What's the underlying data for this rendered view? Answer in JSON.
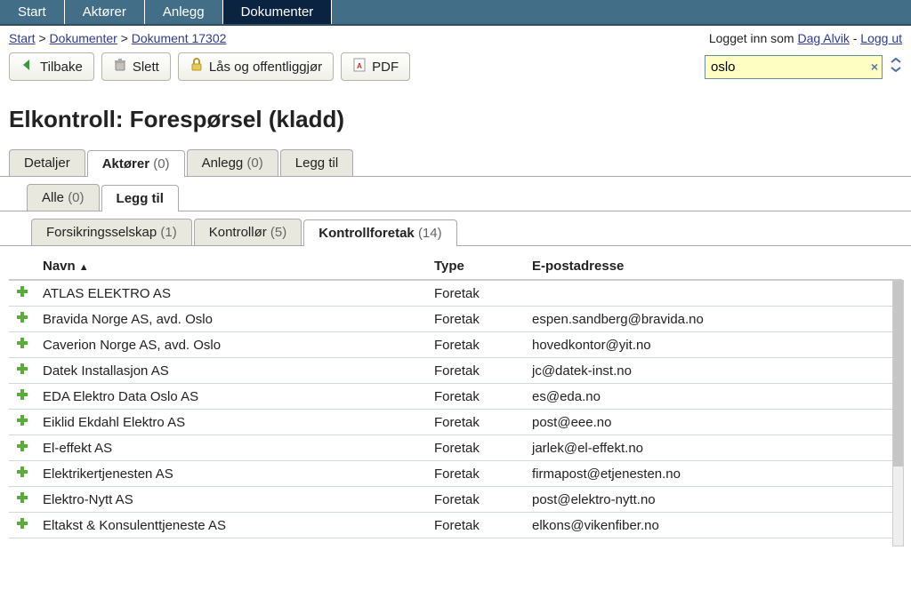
{
  "nav": {
    "start": "Start",
    "aktorer": "Aktører",
    "anlegg": "Anlegg",
    "dokumenter": "Dokumenter"
  },
  "breadcrumb": {
    "start": "Start",
    "dokumenter": "Dokumenter",
    "dokument": "Dokument 17302",
    "sep": ">"
  },
  "user": {
    "logged_in_as_prefix": "Logget inn som ",
    "name": "Dag Alvik",
    "dash": " - ",
    "logout": "Logg ut"
  },
  "toolbar": {
    "back": "Tilbake",
    "delete": "Slett",
    "lock": "Lås og offentliggjør",
    "pdf": "PDF"
  },
  "search": {
    "value": "oslo"
  },
  "title": "Elkontroll: Forespørsel (kladd)",
  "tabs1": {
    "detaljer": "Detaljer",
    "aktorer": "Aktører ",
    "aktorer_count": "(0)",
    "anlegg": "Anlegg ",
    "anlegg_count": "(0)",
    "leggtil": "Legg til"
  },
  "tabs2": {
    "alle": "Alle ",
    "alle_count": "(0)",
    "leggtil": "Legg til"
  },
  "tabs3": {
    "forsikring": "Forsikringsselskap ",
    "forsikring_count": "(1)",
    "kontrollor": "Kontrollør ",
    "kontrollor_count": "(5)",
    "kontrollforetak": "Kontrollforetak ",
    "kontrollforetak_count": "(14)"
  },
  "table": {
    "headers": {
      "navn": "Navn",
      "type": "Type",
      "epost": "E-postadresse"
    },
    "rows": [
      {
        "name": "ATLAS ELEKTRO AS",
        "type": "Foretak",
        "email": ""
      },
      {
        "name": "Bravida Norge AS, avd. Oslo",
        "type": "Foretak",
        "email": "espen.sandberg@bravida.no"
      },
      {
        "name": "Caverion Norge AS, avd. Oslo",
        "type": "Foretak",
        "email": "hovedkontor@yit.no"
      },
      {
        "name": "Datek Installasjon AS",
        "type": "Foretak",
        "email": "jc@datek-inst.no"
      },
      {
        "name": "EDA Elektro Data Oslo AS",
        "type": "Foretak",
        "email": "es@eda.no"
      },
      {
        "name": "Eiklid Ekdahl Elektro AS",
        "type": "Foretak",
        "email": "post@eee.no"
      },
      {
        "name": "El-effekt AS",
        "type": "Foretak",
        "email": "jarlek@el-effekt.no"
      },
      {
        "name": "Elektrikertjenesten AS",
        "type": "Foretak",
        "email": "firmapost@etjenesten.no"
      },
      {
        "name": "Elektro-Nytt AS",
        "type": "Foretak",
        "email": "post@elektro-nytt.no"
      },
      {
        "name": "Eltakst & Konsulenttjeneste AS",
        "type": "Foretak",
        "email": "elkons@vikenfiber.no"
      }
    ]
  }
}
